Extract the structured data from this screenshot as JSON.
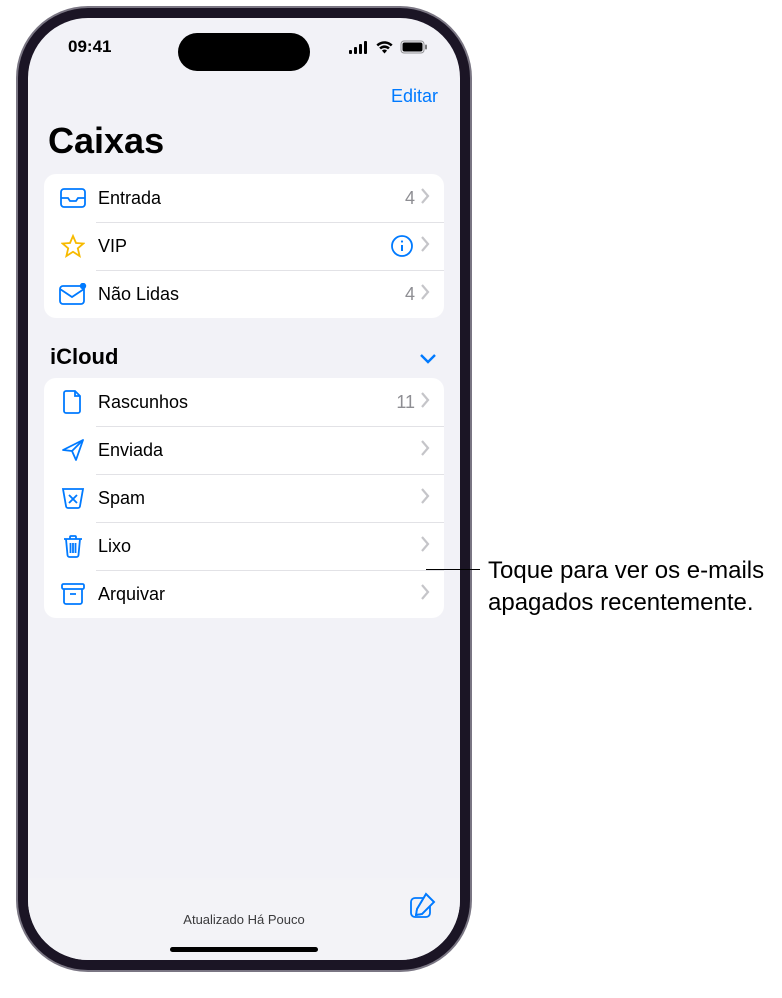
{
  "status": {
    "time": "09:41"
  },
  "nav": {
    "edit": "Editar",
    "title": "Caixas"
  },
  "mailboxes": {
    "items": [
      {
        "label": "Entrada",
        "count": "4"
      },
      {
        "label": "VIP"
      },
      {
        "label": "Não Lidas",
        "count": "4"
      }
    ]
  },
  "section": {
    "title": "iCloud",
    "items": [
      {
        "label": "Rascunhos",
        "count": "11"
      },
      {
        "label": "Enviada"
      },
      {
        "label": "Spam"
      },
      {
        "label": "Lixo"
      },
      {
        "label": "Arquivar"
      }
    ]
  },
  "footer": {
    "status": "Atualizado Há Pouco"
  },
  "callout": {
    "text": "Toque para ver os e-mails apagados recentemente."
  }
}
